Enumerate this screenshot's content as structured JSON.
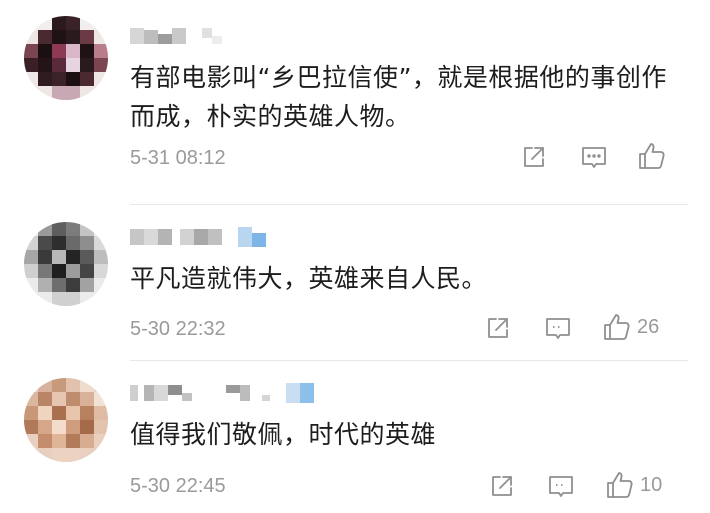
{
  "comments": [
    {
      "text": "有部电影叫“乡巴拉信使”，就是根据他的事创作而成，朴实的英雄人物。",
      "time": "5-31 08:12",
      "likes": ""
    },
    {
      "text": "平凡造就伟大，英雄来自人民。",
      "time": "5-30 22:32",
      "likes": "26"
    },
    {
      "text": "值得我们敬佩，时代的英雄",
      "time": "5-30 22:45",
      "likes": "10"
    }
  ],
  "icons": {
    "share": "share-icon",
    "reply": "comment-icon",
    "like": "thumbs-up-icon"
  },
  "colors": {
    "text": "#1d1d1d",
    "meta": "#9a9a9a",
    "divider": "#e8e8e8"
  }
}
